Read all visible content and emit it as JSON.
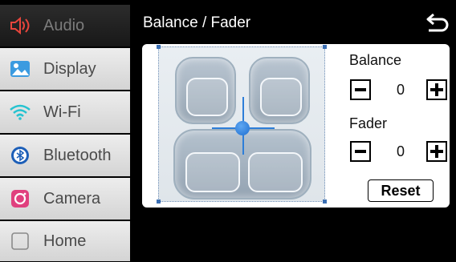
{
  "header": {
    "title": "Balance / Fader",
    "back_icon": "back-arrow-icon"
  },
  "sidebar": {
    "items": [
      {
        "label": "Audio",
        "icon": "speaker-icon",
        "active": true
      },
      {
        "label": "Display",
        "icon": "picture-icon",
        "active": false
      },
      {
        "label": "Wi-Fi",
        "icon": "wifi-icon",
        "active": false
      },
      {
        "label": "Bluetooth",
        "icon": "bluetooth-icon",
        "active": false
      },
      {
        "label": "Camera",
        "icon": "camera-icon",
        "active": false
      },
      {
        "label": "Home",
        "icon": "home-icon",
        "active": false
      }
    ]
  },
  "controls": {
    "balance": {
      "label": "Balance",
      "value": "0"
    },
    "fader": {
      "label": "Fader",
      "value": "0"
    },
    "reset_label": "Reset"
  },
  "colors": {
    "accent": "#2e7ed8",
    "active_icon": "#e8453c",
    "sidebar_bg": "#e2e2e2"
  }
}
